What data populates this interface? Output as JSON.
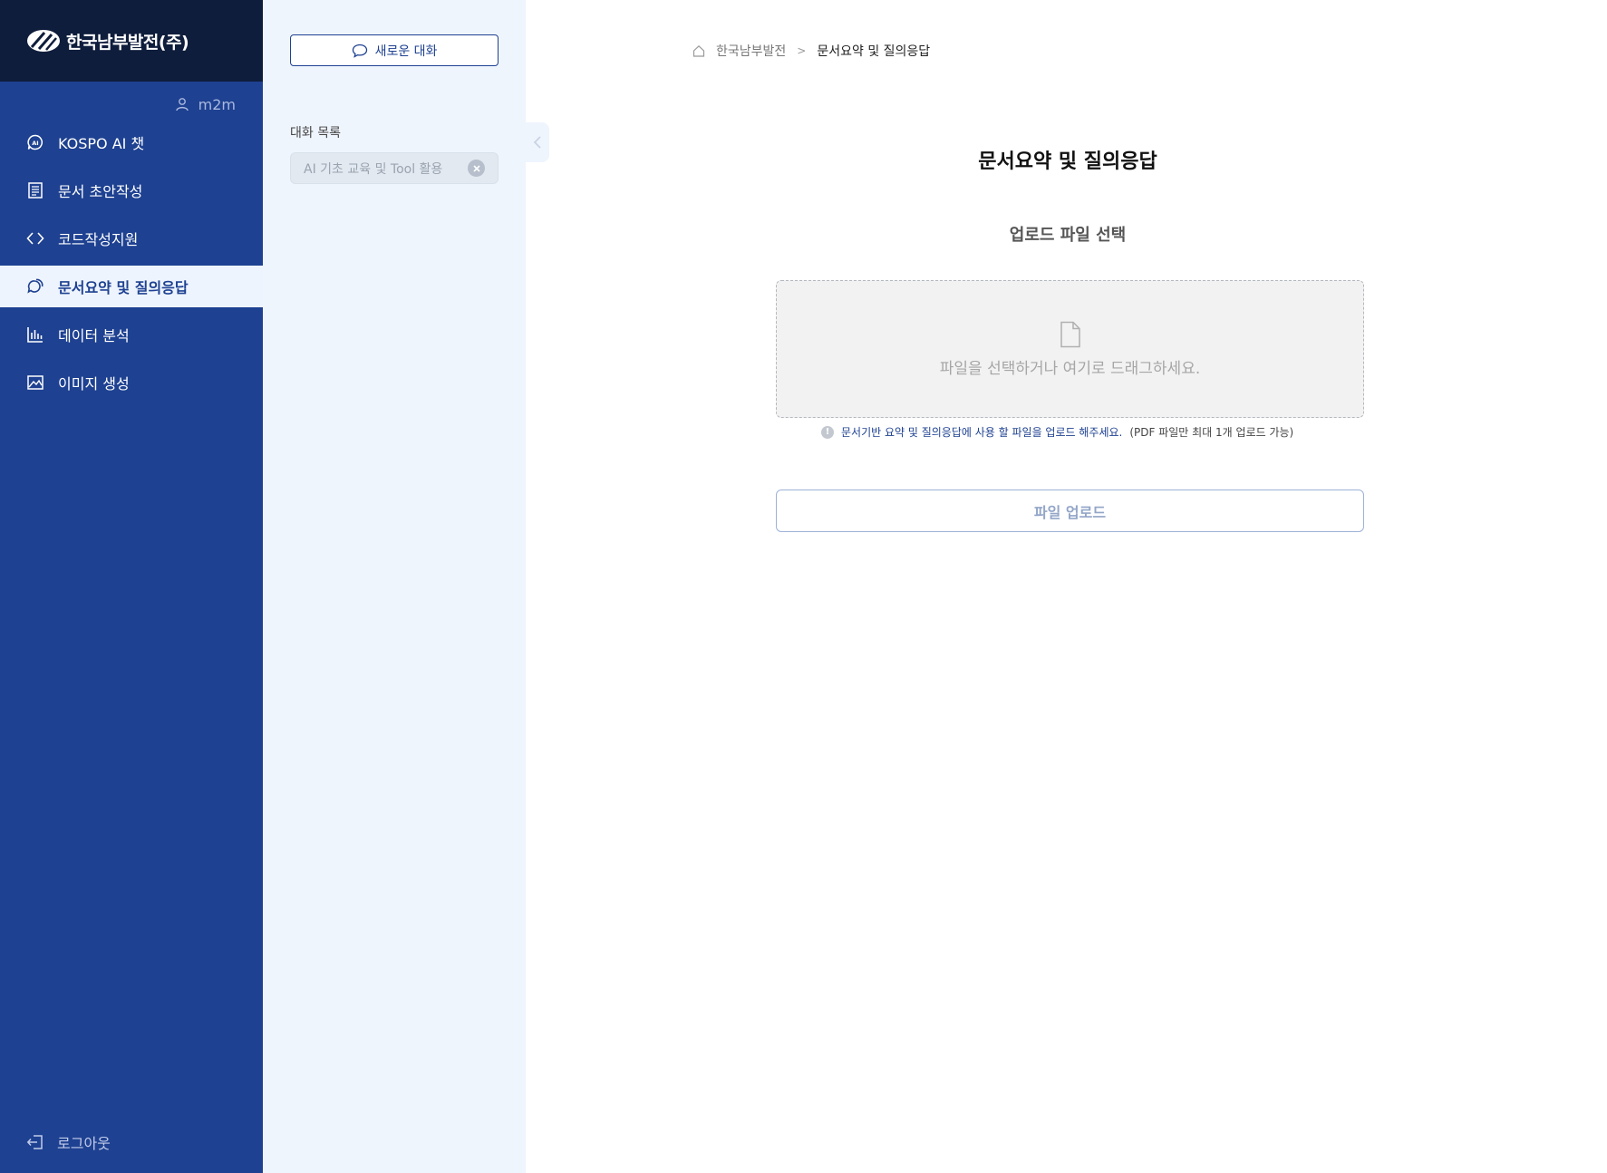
{
  "brand": {
    "logo_text": "한국남부발전(주)"
  },
  "user": {
    "name": "m2m"
  },
  "nav": {
    "items": [
      {
        "label": "KOSPO AI 챗",
        "icon": "ai-chat-icon",
        "active": false
      },
      {
        "label": "문서 초안작성",
        "icon": "document-icon",
        "active": false
      },
      {
        "label": "코드작성지원",
        "icon": "code-icon",
        "active": false
      },
      {
        "label": "문서요약 및 질의응답",
        "icon": "chat-bubble-icon",
        "active": true
      },
      {
        "label": "데이터 분석",
        "icon": "bar-chart-icon",
        "active": false
      },
      {
        "label": "이미지 생성",
        "icon": "image-icon",
        "active": false
      }
    ],
    "logout_label": "로그아웃"
  },
  "conversations": {
    "new_chat_label": "새로운 대화",
    "list_title": "대화 목록",
    "items": [
      {
        "title": "AI 기초 교육 및 Tool 활용"
      }
    ]
  },
  "breadcrumb": {
    "home": "한국남부발전",
    "separator": ">",
    "current": "문서요약 및 질의응답"
  },
  "main": {
    "title": "문서요약 및 질의응답",
    "section_title": "업로드 파일 선택",
    "dropzone_text": "파일을 선택하거나 여기로 드래그하세요.",
    "hint_main": "문서기반 요약 및 질의응답에 사용 할 파일을 업로드 해주세요.",
    "hint_sub": "(PDF 파일만 최대 1개 업로드 가능)",
    "hint_icon": "!",
    "upload_button": "파일 업로드"
  },
  "colors": {
    "nav_bg": "#1e4191",
    "logo_bg": "#0f1d3c",
    "panel_bg": "#eff5fd",
    "accent": "#1e4191"
  }
}
